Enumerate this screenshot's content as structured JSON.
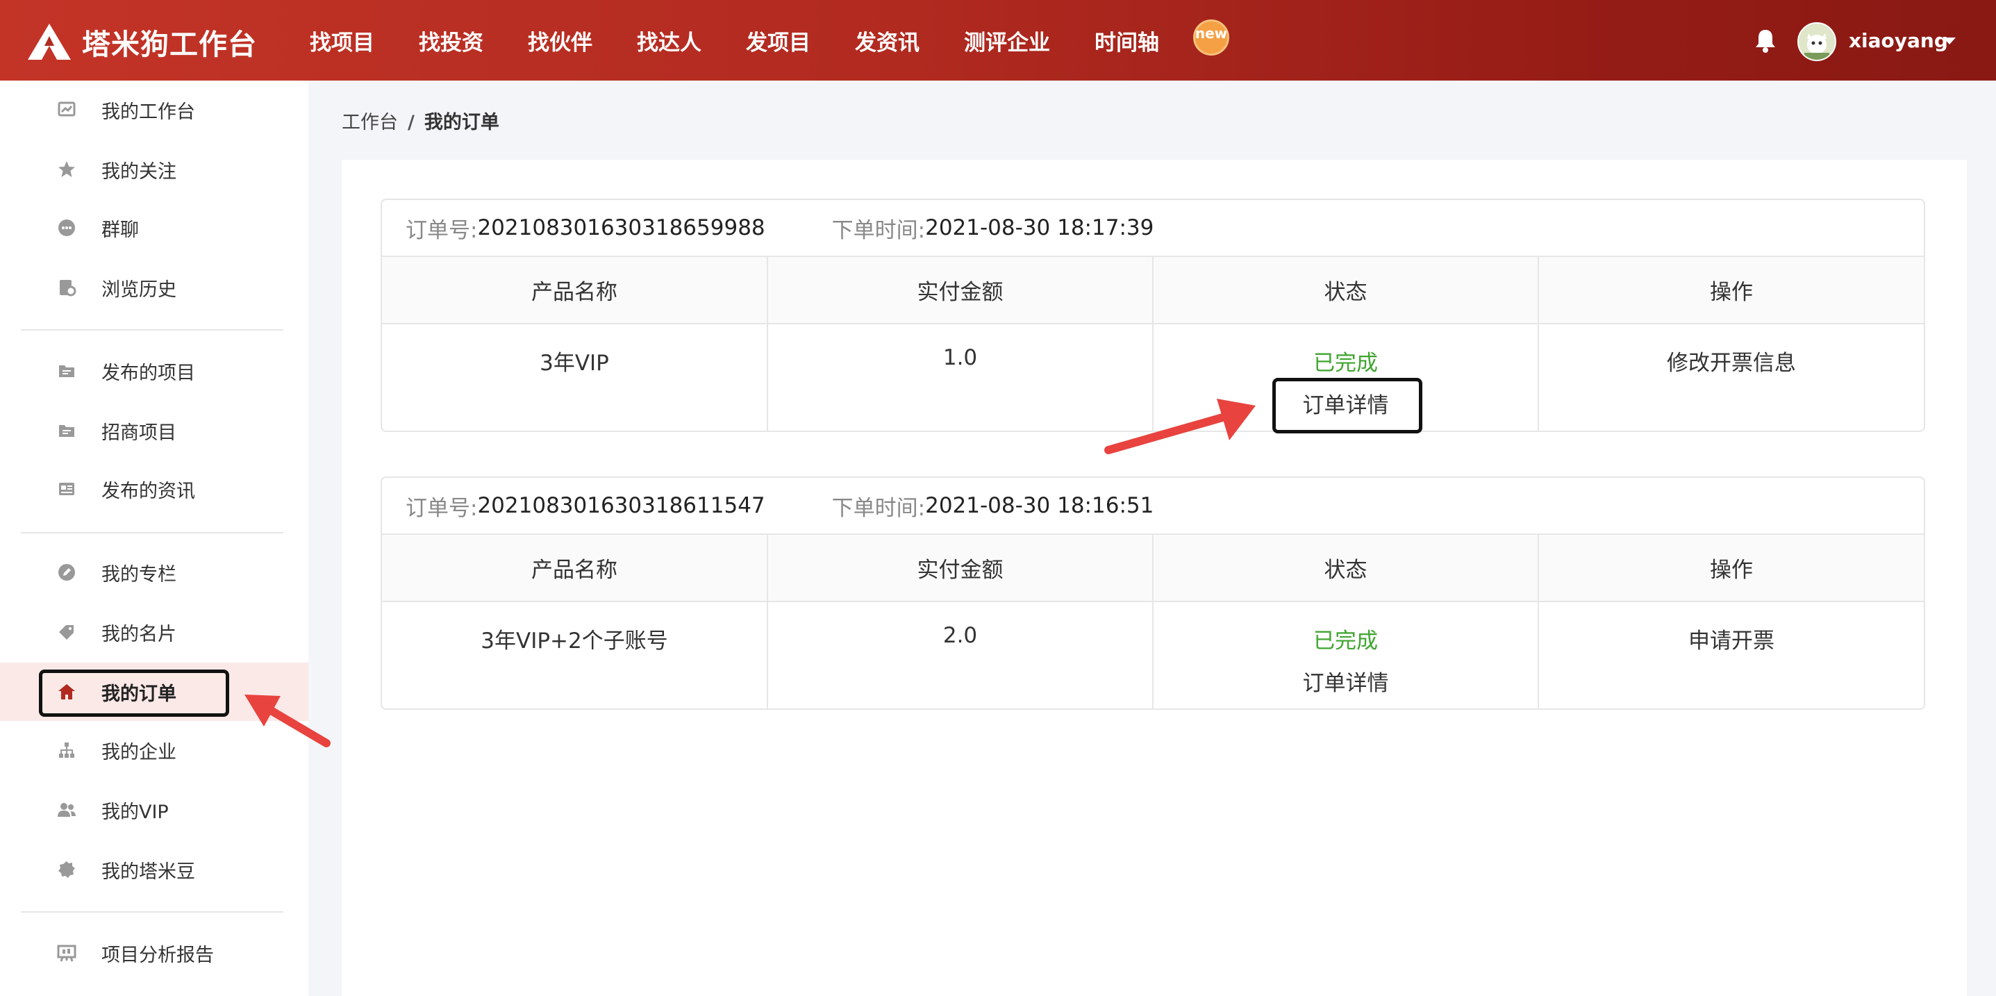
{
  "brand": {
    "name": "塔米狗工作台"
  },
  "nav": {
    "items": [
      "找项目",
      "找投资",
      "找伙伴",
      "找达人",
      "发项目",
      "发资讯",
      "测评企业",
      "时间轴"
    ],
    "new_badge": "new"
  },
  "user": {
    "name": "xiaoyang"
  },
  "sidebar": {
    "items": [
      {
        "label": "我的工作台",
        "icon": "chart-icon"
      },
      {
        "label": "我的关注",
        "icon": "star-icon"
      },
      {
        "label": "群聊",
        "icon": "chat-icon"
      },
      {
        "label": "浏览历史",
        "icon": "history-icon"
      },
      {
        "label": "发布的项目",
        "icon": "folder-icon"
      },
      {
        "label": "招商项目",
        "icon": "folder-icon"
      },
      {
        "label": "发布的资讯",
        "icon": "news-icon"
      },
      {
        "label": "我的专栏",
        "icon": "pen-icon"
      },
      {
        "label": "我的名片",
        "icon": "tag-icon"
      },
      {
        "label": "我的订单",
        "icon": "home-icon"
      },
      {
        "label": "我的企业",
        "icon": "org-icon"
      },
      {
        "label": "我的VIP",
        "icon": "users-icon"
      },
      {
        "label": "我的塔米豆",
        "icon": "coin-icon"
      },
      {
        "label": "项目分析报告",
        "icon": "report-icon"
      }
    ],
    "active": "我的订单"
  },
  "breadcrumb": {
    "root": "工作台",
    "sep": "/",
    "current": "我的订单"
  },
  "orders": [
    {
      "no_label": "订单号:",
      "no": "20210830163031865 9988",
      "time_label": "下单时间:",
      "time": "2021-08-30 18:17:39",
      "headers": [
        "产品名称",
        "实付金额",
        "状态",
        "操作"
      ],
      "product": "3年VIP",
      "amount": "1.0",
      "status": "已完成",
      "detail": "订单详情",
      "action": "修改开票信息"
    },
    {
      "no_label": "订单号:",
      "no": "20210830163031861 1547",
      "time_label": "下单时间:",
      "time": "2021-08-30 18:16:51",
      "headers": [
        "产品名称",
        "实付金额",
        "状态",
        "操作"
      ],
      "product": "3年VIP+2个子账号",
      "amount": "2.0",
      "status": "已完成",
      "detail": "订单详情",
      "action": "申请开票"
    }
  ],
  "colors": {
    "brand_red": "#b12a20",
    "status_green": "#3fa52f",
    "active_bg": "#fbe9e8",
    "arrow_red": "#e8433e"
  }
}
